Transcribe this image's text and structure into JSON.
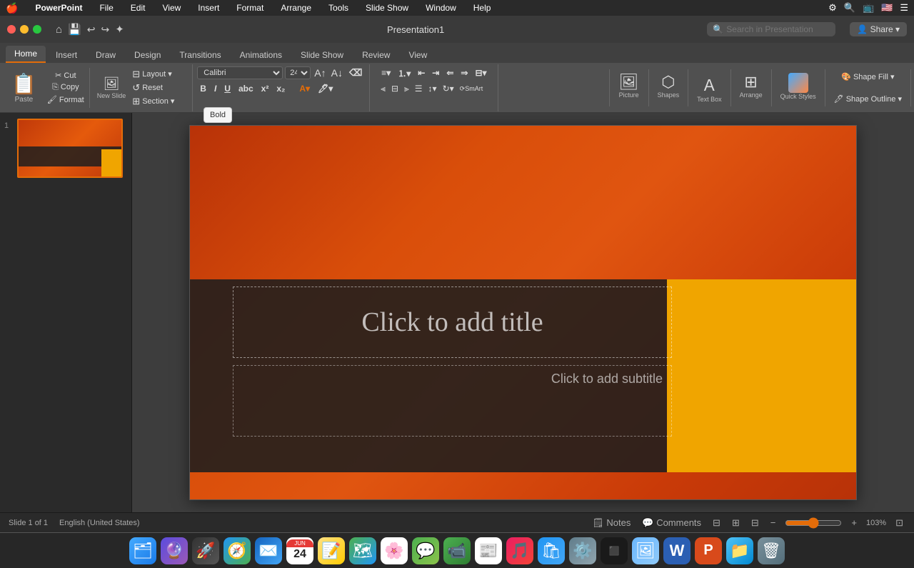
{
  "menubar": {
    "apple": "🍎",
    "app_name": "PowerPoint",
    "items": [
      "File",
      "Edit",
      "View",
      "Insert",
      "Format",
      "Arrange",
      "Tools",
      "Slide Show",
      "Window",
      "Help"
    ]
  },
  "titlebar": {
    "title": "Presentation1",
    "search_placeholder": "Search in Presentation"
  },
  "ribbon_tabs": [
    "Home",
    "Insert",
    "Draw",
    "Design",
    "Transitions",
    "Animations",
    "Slide Show",
    "Review",
    "View"
  ],
  "active_tab": "Home",
  "ribbon": {
    "paste_label": "Paste",
    "cut_label": "Cut",
    "copy_label": "Copy",
    "format_label": "Format",
    "new_slide_label": "New Slide",
    "layout_label": "Layout",
    "reset_label": "Reset",
    "section_label": "Section",
    "font_placeholder": "Calibri",
    "font_size": "24",
    "bold": "B",
    "italic": "I",
    "underline": "U",
    "strikethrough": "abc",
    "superscript": "x²",
    "subscript": "x₂",
    "font_size_up": "A↑",
    "font_size_down": "A↓",
    "picture_label": "Picture",
    "shapes_label": "Shapes",
    "text_box_label": "Text Box",
    "arrange_label": "Arrange",
    "quick_styles_label": "Quick Styles",
    "convert_label": "Convert to SmartArt",
    "shape_fill_label": "Shape Fill",
    "shape_outline_label": "Shape Outline"
  },
  "slide": {
    "title_placeholder": "Click to add title",
    "subtitle_placeholder": "Click to add subtitle"
  },
  "statusbar": {
    "slide_info": "Slide 1 of 1",
    "language": "English (United States)",
    "notes_label": "Notes",
    "comments_label": "Comments",
    "zoom_level": "103%"
  },
  "tooltip": {
    "text": "Bold"
  },
  "dock_icons": [
    {
      "name": "finder",
      "symbol": "🗂",
      "color": "#1a7ae8",
      "bg": "#1a7ae8"
    },
    {
      "name": "siri",
      "symbol": "🔮",
      "color": "#8f5ee8",
      "bg": "#5b4cde"
    },
    {
      "name": "launchpad",
      "symbol": "🚀",
      "color": "#555",
      "bg": "#333"
    },
    {
      "name": "safari",
      "symbol": "🧭",
      "color": "#2196f3",
      "bg": "#2196f3"
    },
    {
      "name": "mail",
      "symbol": "✉️",
      "color": "#555",
      "bg": "#444"
    },
    {
      "name": "calendar",
      "symbol": "📅",
      "color": "#f44",
      "bg": "#f44"
    },
    {
      "name": "notes",
      "symbol": "📝",
      "color": "#f5e642",
      "bg": "#ddd"
    },
    {
      "name": "maps",
      "symbol": "🗺",
      "color": "#4caf50",
      "bg": "#4caf50"
    },
    {
      "name": "photos",
      "symbol": "🌸",
      "color": "#e91e63",
      "bg": "#f06"
    },
    {
      "name": "messages",
      "symbol": "💬",
      "color": "#4caf50",
      "bg": "#4caf50"
    },
    {
      "name": "facetime",
      "symbol": "📹",
      "color": "#4caf50",
      "bg": "#4caf50"
    },
    {
      "name": "news",
      "symbol": "📰",
      "color": "#f44",
      "bg": "#f44"
    },
    {
      "name": "music",
      "symbol": "🎵",
      "color": "#f50",
      "bg": "#555"
    },
    {
      "name": "appstore",
      "symbol": "🛍",
      "color": "#2196f3",
      "bg": "#2196f3"
    },
    {
      "name": "systemprefs",
      "symbol": "⚙️",
      "color": "#888",
      "bg": "#555"
    },
    {
      "name": "terminal",
      "symbol": "⬛",
      "color": "#333",
      "bg": "#111"
    },
    {
      "name": "preview",
      "symbol": "🖼",
      "color": "#6af",
      "bg": "#6af"
    },
    {
      "name": "word",
      "symbol": "W",
      "color": "#2b5fb3",
      "bg": "#2b5fb3"
    },
    {
      "name": "powerpoint",
      "symbol": "P",
      "color": "#d84a1b",
      "bg": "#d84a1b"
    },
    {
      "name": "finder2",
      "symbol": "📁",
      "color": "#1a7ae8",
      "bg": "#4af"
    },
    {
      "name": "trash",
      "symbol": "🗑",
      "color": "#888",
      "bg": "#555"
    }
  ]
}
